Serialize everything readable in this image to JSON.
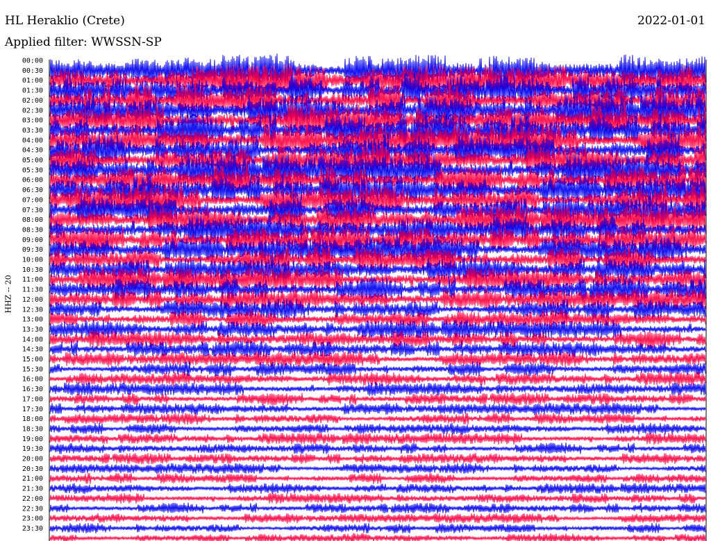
{
  "header": {
    "station": "HL Heraklio (Crete)",
    "date": "2022-01-01",
    "filter": "Applied filter: WWSSN-SP",
    "channel": "HHZ -- 20"
  },
  "colors": {
    "trace_a": "#0000ee",
    "trace_b": "#ff0040",
    "axis": "#000000"
  },
  "chart_data": {
    "type": "line",
    "title": "HL Heraklio (Crete)",
    "ylabel": "HHZ -- 20",
    "ytick_labels": [
      "00:00",
      "00:30",
      "01:00",
      "01:30",
      "02:00",
      "02:30",
      "03:00",
      "03:30",
      "04:00",
      "04:30",
      "05:00",
      "05:30",
      "06:00",
      "06:30",
      "07:00",
      "07:30",
      "08:00",
      "08:30",
      "09:00",
      "09:30",
      "10:00",
      "10:30",
      "11:00",
      "11:30",
      "12:00",
      "12:30",
      "13:00",
      "13:30",
      "14:00",
      "14:30",
      "15:00",
      "15:30",
      "16:00",
      "16:30",
      "17:00",
      "17:30",
      "18:00",
      "18:30",
      "19:00",
      "19:30",
      "20:00",
      "20:30",
      "21:00",
      "21:30",
      "22:00",
      "22:30",
      "23:00",
      "23:30"
    ],
    "row_amplitude": [
      1.0,
      1.0,
      0.98,
      0.98,
      0.97,
      0.97,
      0.96,
      0.96,
      0.95,
      0.95,
      0.93,
      0.92,
      0.9,
      0.9,
      0.88,
      0.87,
      0.85,
      0.82,
      0.8,
      0.78,
      0.75,
      0.72,
      0.7,
      0.66,
      0.62,
      0.58,
      0.55,
      0.52,
      0.5,
      0.47,
      0.45,
      0.42,
      0.4,
      0.38,
      0.37,
      0.36,
      0.35,
      0.35,
      0.34,
      0.34,
      0.33,
      0.33,
      0.32,
      0.32,
      0.32,
      0.31,
      0.31,
      0.3
    ],
    "series": [
      {
        "color": "#0000ee",
        "rows": "even"
      },
      {
        "color": "#ff0040",
        "rows": "odd"
      }
    ],
    "grid": false,
    "legend": "none"
  }
}
